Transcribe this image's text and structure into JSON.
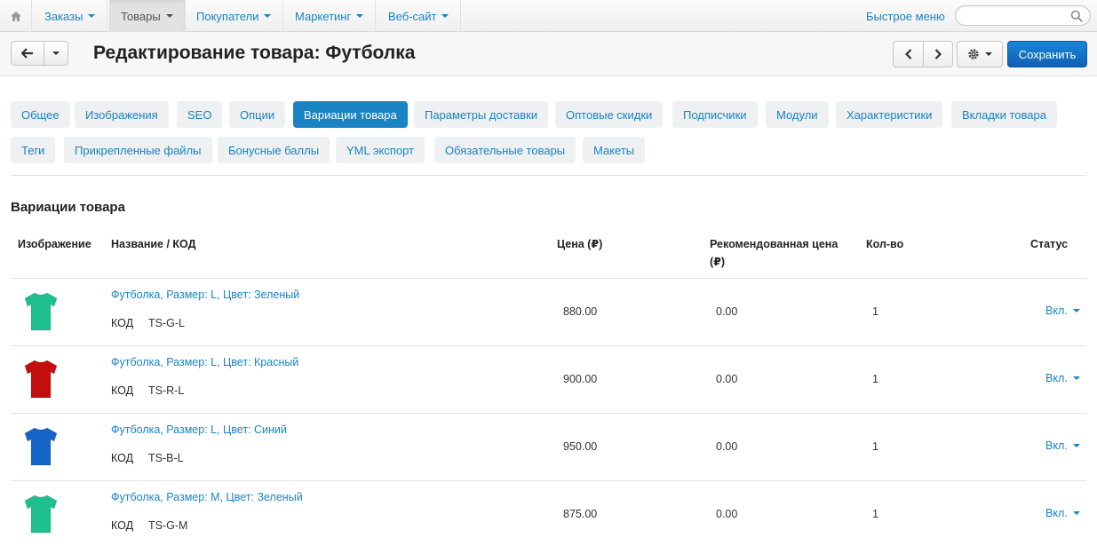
{
  "nav": {
    "items": [
      {
        "label": "Заказы"
      },
      {
        "label": "Товары"
      },
      {
        "label": "Покупатели"
      },
      {
        "label": "Маркетинг"
      },
      {
        "label": "Веб-сайт"
      }
    ],
    "quick_menu": "Быстрое меню",
    "search_placeholder": "",
    "home_icon": "home-icon"
  },
  "header": {
    "title": "Редактирование товара: Футболка",
    "save_label": "Сохранить"
  },
  "tabs": {
    "row1": [
      "Общее",
      "Изображения",
      "SEO",
      "Опции",
      "Вариации товара",
      "Параметры доставки",
      "Оптовые скидки",
      "Подписчики",
      "Модули",
      "Характеристики",
      "Вкладки товара"
    ],
    "row2": [
      "Теги",
      "Прикрепленные файлы",
      "Бонусные баллы",
      "YML экспорт",
      "Обязательные товары",
      "Макеты"
    ],
    "active": "Вариации товара"
  },
  "section_title": "Вариации товара",
  "table": {
    "headers": {
      "image": "Изображение",
      "name": "Название / КОД",
      "price": "Цена (₽)",
      "rec_price_1": "Рекомендованная цена",
      "rec_price_2": "(₽)",
      "qty": "Кол-во",
      "status": "Статус"
    },
    "code_label": "КОД",
    "rows": [
      {
        "name": "Футболка, Размер: L, Цвет: Зеленый",
        "code": "TS-G-L",
        "price": "880.00",
        "rec_price": "0.00",
        "qty": "1",
        "status": "Вкл.",
        "color": "#1fbf8f"
      },
      {
        "name": "Футболка, Размер: L, Цвет: Красный",
        "code": "TS-R-L",
        "price": "900.00",
        "rec_price": "0.00",
        "qty": "1",
        "status": "Вкл.",
        "color": "#c40d0d"
      },
      {
        "name": "Футболка, Размер: L, Цвет: Синий",
        "code": "TS-B-L",
        "price": "950.00",
        "rec_price": "0.00",
        "qty": "1",
        "status": "Вкл.",
        "color": "#1565c8"
      },
      {
        "name": "Футболка, Размер: M, Цвет: Зеленый",
        "code": "TS-G-M",
        "price": "875.00",
        "rec_price": "0.00",
        "qty": "1",
        "status": "Вкл.",
        "color": "#1fbf8f"
      }
    ]
  },
  "colors": {
    "accent": "#1a83c4",
    "save_button": "#1479cc"
  }
}
